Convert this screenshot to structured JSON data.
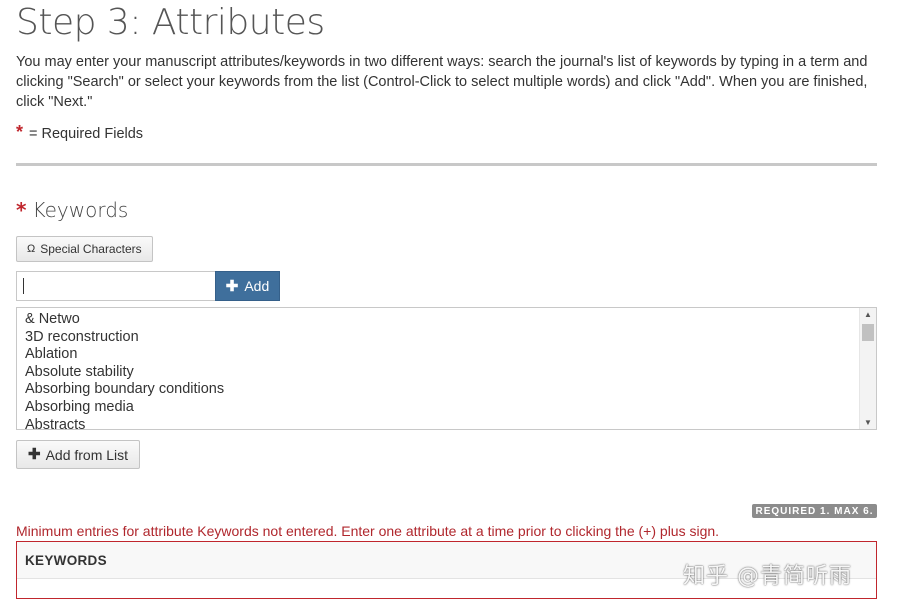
{
  "page": {
    "title": "Step 3: Attributes",
    "intro": "You may enter your manuscript attributes/keywords in two different ways: search the journal's list of keywords by typing in a term and clicking \"Search\" or select your keywords from the list (Control-Click to select multiple words) and click \"Add\". When you are finished, click \"Next.\"",
    "required_star": "*",
    "required_label": "= Required Fields"
  },
  "keywords": {
    "heading": "Keywords",
    "special_chars_icon": "Ω",
    "special_chars_label": "Special Characters",
    "input_value": "",
    "add_label": "Add",
    "list_items": [
      "& Netwo",
      "3D reconstruction",
      "Ablation",
      "Absolute stability",
      "Absorbing boundary conditions",
      "Absorbing media",
      "Abstracts"
    ],
    "add_from_list_label": "Add from List",
    "required_badge": "REQUIRED 1. MAX 6.",
    "error": "Minimum entries for attribute Keywords not entered. Enter one attribute at a time prior to clicking the (+) plus sign.",
    "table_header": "KEYWORDS"
  },
  "watermark": "知乎 @青简听雨",
  "colors": {
    "accent": "#3f6f9c",
    "error": "#b0272d",
    "required": "#c0262d"
  }
}
